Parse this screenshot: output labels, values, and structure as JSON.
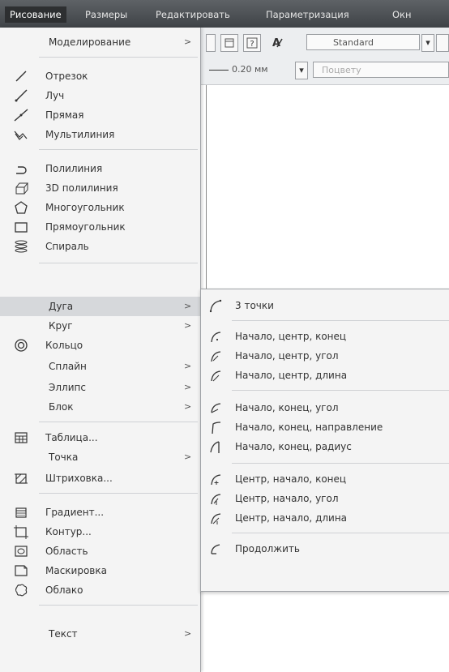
{
  "menubar": [
    "Рисование",
    "Размеры",
    "Редактировать",
    "Параметризация",
    "Окн"
  ],
  "toolbar": {
    "style_combo": "Standard",
    "lineweight_combo": "0.20 мм",
    "color_combo": "Поцвету"
  },
  "menu": {
    "items": [
      {
        "label": "Моделирование",
        "arrow": ">"
      },
      {
        "label": "Отрезок"
      },
      {
        "label": "Луч"
      },
      {
        "label": "Прямая"
      },
      {
        "label": "Мультилиния"
      },
      {
        "label": "Полилиния"
      },
      {
        "label": "3D полилиния"
      },
      {
        "label": "Многоугольник"
      },
      {
        "label": "Прямоугольник"
      },
      {
        "label": "Спираль"
      },
      {
        "label": "Дуга",
        "arrow": ">"
      },
      {
        "label": "Круг",
        "arrow": ">"
      },
      {
        "label": "Кольцо"
      },
      {
        "label": "Сплайн",
        "arrow": ">"
      },
      {
        "label": "Эллипс",
        "arrow": ">"
      },
      {
        "label": "Блок",
        "arrow": ">"
      },
      {
        "label": "Таблица..."
      },
      {
        "label": "Точка",
        "arrow": ">"
      },
      {
        "label": "Штриховка..."
      },
      {
        "label": "Градиент..."
      },
      {
        "label": "Контур..."
      },
      {
        "label": "Область"
      },
      {
        "label": "Маскировка"
      },
      {
        "label": "Облако"
      },
      {
        "label": "Текст",
        "arrow": ">"
      }
    ]
  },
  "submenu": {
    "items": [
      {
        "label": "3 точки"
      },
      {
        "label": "Начало, центр, конец"
      },
      {
        "label": "Начало, центр, угол"
      },
      {
        "label": "Начало, центр, длина"
      },
      {
        "label": "Начало, конец, угол"
      },
      {
        "label": "Начало, конец, направление"
      },
      {
        "label": "Начало, конец, радиус"
      },
      {
        "label": "Центр, начало, конец"
      },
      {
        "label": "Центр, начало, угол"
      },
      {
        "label": "Центр, начало, длина"
      },
      {
        "label": "Продолжить"
      }
    ]
  }
}
